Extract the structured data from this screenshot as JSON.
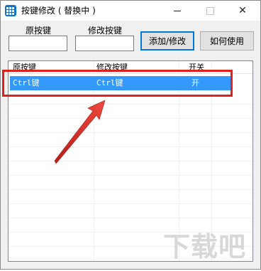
{
  "window": {
    "title": "按键修改 ( 替换中 )",
    "controls": {
      "minimize": "minimize",
      "maximize": "maximize",
      "close": "✕"
    }
  },
  "form": {
    "original_key_label": "原按键",
    "original_key_value": "",
    "modified_key_label": "修改按键",
    "modified_key_value": "",
    "add_modify_button": "添加/修改",
    "how_to_use_button": "如何使用"
  },
  "table": {
    "columns": [
      "原按键",
      "修改按键",
      "开关"
    ],
    "rows": [
      {
        "original": "Ctrl键",
        "modified": "Ctrl键",
        "switch": "开"
      }
    ]
  },
  "colors": {
    "selection": "#3399ff",
    "highlight_box": "#e0201c",
    "arrow": "#d42a22",
    "app_icon": "#0f74c8"
  },
  "watermark": "下载吧"
}
